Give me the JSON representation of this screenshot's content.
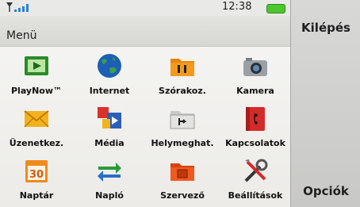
{
  "status": {
    "time": "12:38"
  },
  "header": {
    "title": "Menü"
  },
  "softkeys": {
    "exit": "Kilépés",
    "options": "Opciók"
  },
  "menu_items": [
    {
      "label": "PlayNow™",
      "icon": "playnow-icon"
    },
    {
      "label": "Internet",
      "icon": "globe-icon"
    },
    {
      "label": "Szórakoz.",
      "icon": "entertainment-folder-icon"
    },
    {
      "label": "Kamera",
      "icon": "camera-icon"
    },
    {
      "label": "Üzenetkez.",
      "icon": "envelope-icon"
    },
    {
      "label": "Média",
      "icon": "media-icon"
    },
    {
      "label": "Helymeghat.",
      "icon": "location-icon"
    },
    {
      "label": "Kapcsolatok",
      "icon": "contacts-book-icon"
    },
    {
      "label": "Naptár",
      "icon": "calendar-icon",
      "day": "30"
    },
    {
      "label": "Napló",
      "icon": "call-log-icon"
    },
    {
      "label": "Szervező",
      "icon": "organizer-icon"
    },
    {
      "label": "Beállítások",
      "icon": "settings-tools-icon"
    }
  ]
}
